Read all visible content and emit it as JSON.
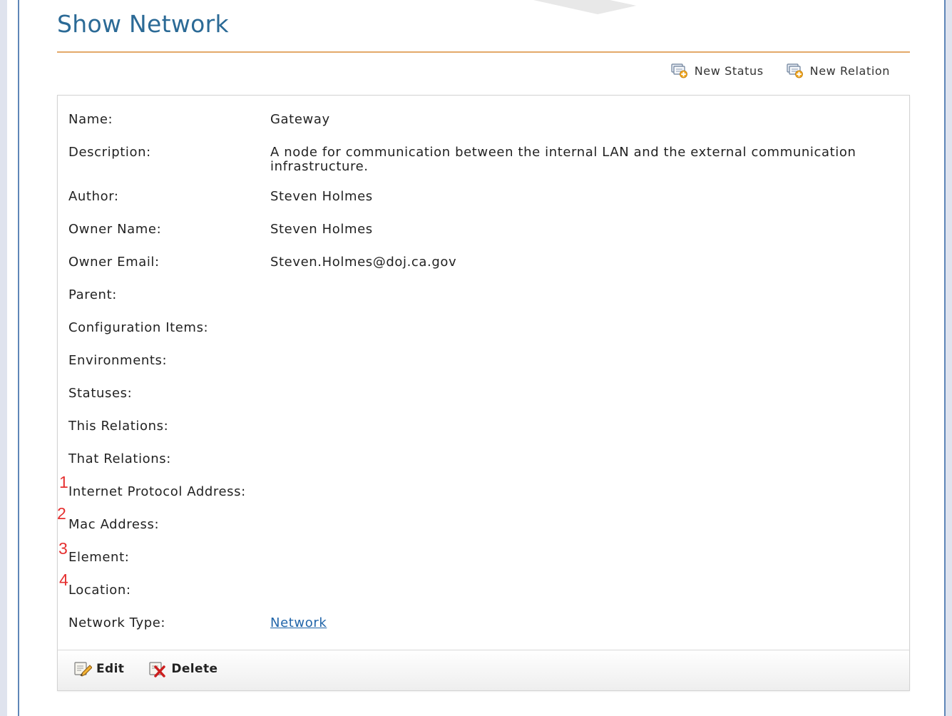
{
  "page": {
    "title": "Show Network"
  },
  "actions": [
    {
      "label": "New Status",
      "icon": "new-status-icon"
    },
    {
      "label": "New Relation",
      "icon": "new-relation-icon"
    }
  ],
  "fields": [
    {
      "label": "Name:",
      "value": "Gateway"
    },
    {
      "label": "Description:",
      "value": "A node for communication between the internal LAN and the external communication infrastructure."
    },
    {
      "label": "Author:",
      "value": "Steven Holmes"
    },
    {
      "label": "Owner Name:",
      "value": "Steven Holmes"
    },
    {
      "label": "Owner Email:",
      "value": "Steven.Holmes@doj.ca.gov"
    },
    {
      "label": "Parent:",
      "value": ""
    },
    {
      "label": "Configuration Items:",
      "value": ""
    },
    {
      "label": "Environments:",
      "value": ""
    },
    {
      "label": "Statuses:",
      "value": ""
    },
    {
      "label": "This Relations:",
      "value": ""
    },
    {
      "label": "That Relations:",
      "value": ""
    },
    {
      "label": "Internet Protocol Address:",
      "value": "",
      "annotation": "1"
    },
    {
      "label": "Mac Address:",
      "value": "",
      "annotation": "2"
    },
    {
      "label": "Element:",
      "value": "",
      "annotation": "3"
    },
    {
      "label": "Location:",
      "value": "",
      "annotation": "4"
    },
    {
      "label": "Network Type:",
      "value": "Network",
      "link": true
    }
  ],
  "footer": {
    "edit_label": "Edit",
    "delete_label": "Delete"
  },
  "colors": {
    "title": "#2b6a96",
    "title_rule": "#e3a96a",
    "link": "#2266aa",
    "annotation": "#e53030",
    "frame": "#5f86b8"
  }
}
